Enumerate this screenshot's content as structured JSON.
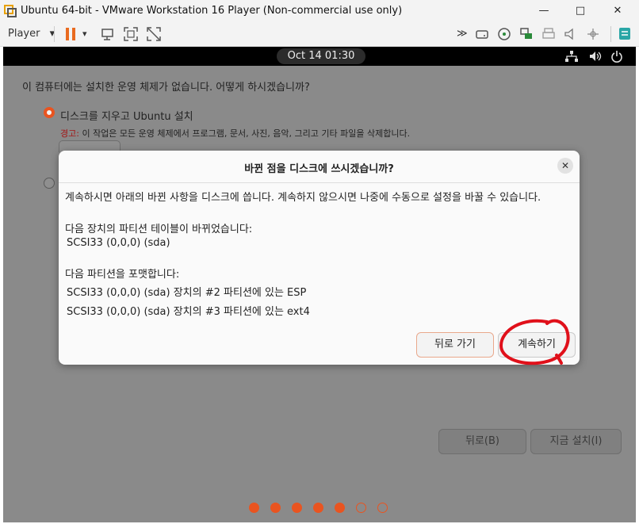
{
  "window": {
    "title": "Ubuntu 64-bit - VMware Workstation 16 Player (Non-commercial use only)",
    "minimize": "—",
    "maximize": "□",
    "close": "✕"
  },
  "toolbar": {
    "player_label": "Player",
    "player_caret": "▾",
    "pause_caret": "▾",
    "more": "≫"
  },
  "topbar": {
    "clock": "Oct 14  01:30"
  },
  "installer": {
    "question": "이 컴퓨터에는 설치한 운영 체제가 없습니다. 어떻게 하시겠습니까?",
    "option_erase": "디스크를 지우고 Ubuntu 설치",
    "warning_label": "경고:",
    "warning_text": " 이 작업은 모든 운영 체제에서 프로그램, 문서, 사진, 음악, 그리고 기타 파일을 삭제합니다.",
    "back_button": "뒤로(B)",
    "install_button": "지금 설치(I)",
    "progress": {
      "total": 7,
      "completed": 5
    }
  },
  "dialog": {
    "title": "바뀐 점을 디스크에 쓰시겠습니까?",
    "close": "✕",
    "intro": "계속하시면 아래의 바뀐 사항을 디스크에 씁니다. 계속하지 않으시면 나중에 수동으로 설정을 바꿀 수 있습니다.",
    "partition_table_heading": "다음 장치의 파티션 테이블이 바뀌었습니다:",
    "partition_table_device": "SCSI33 (0,0,0) (sda)",
    "format_heading": "다음 파티션을 포맷합니다:",
    "format_item_1": "SCSI33 (0,0,0) (sda) 장치의 #2 파티션에 있는 ESP",
    "format_item_2": "SCSI33 (0,0,0) (sda) 장치의 #3 파티션에 있는 ext4",
    "go_back_button": "뒤로 가기",
    "continue_button": "계속하기"
  },
  "colors": {
    "ubuntu_orange": "#e95420",
    "annotation_red": "#e0101a",
    "warning_red": "#c01c28"
  }
}
